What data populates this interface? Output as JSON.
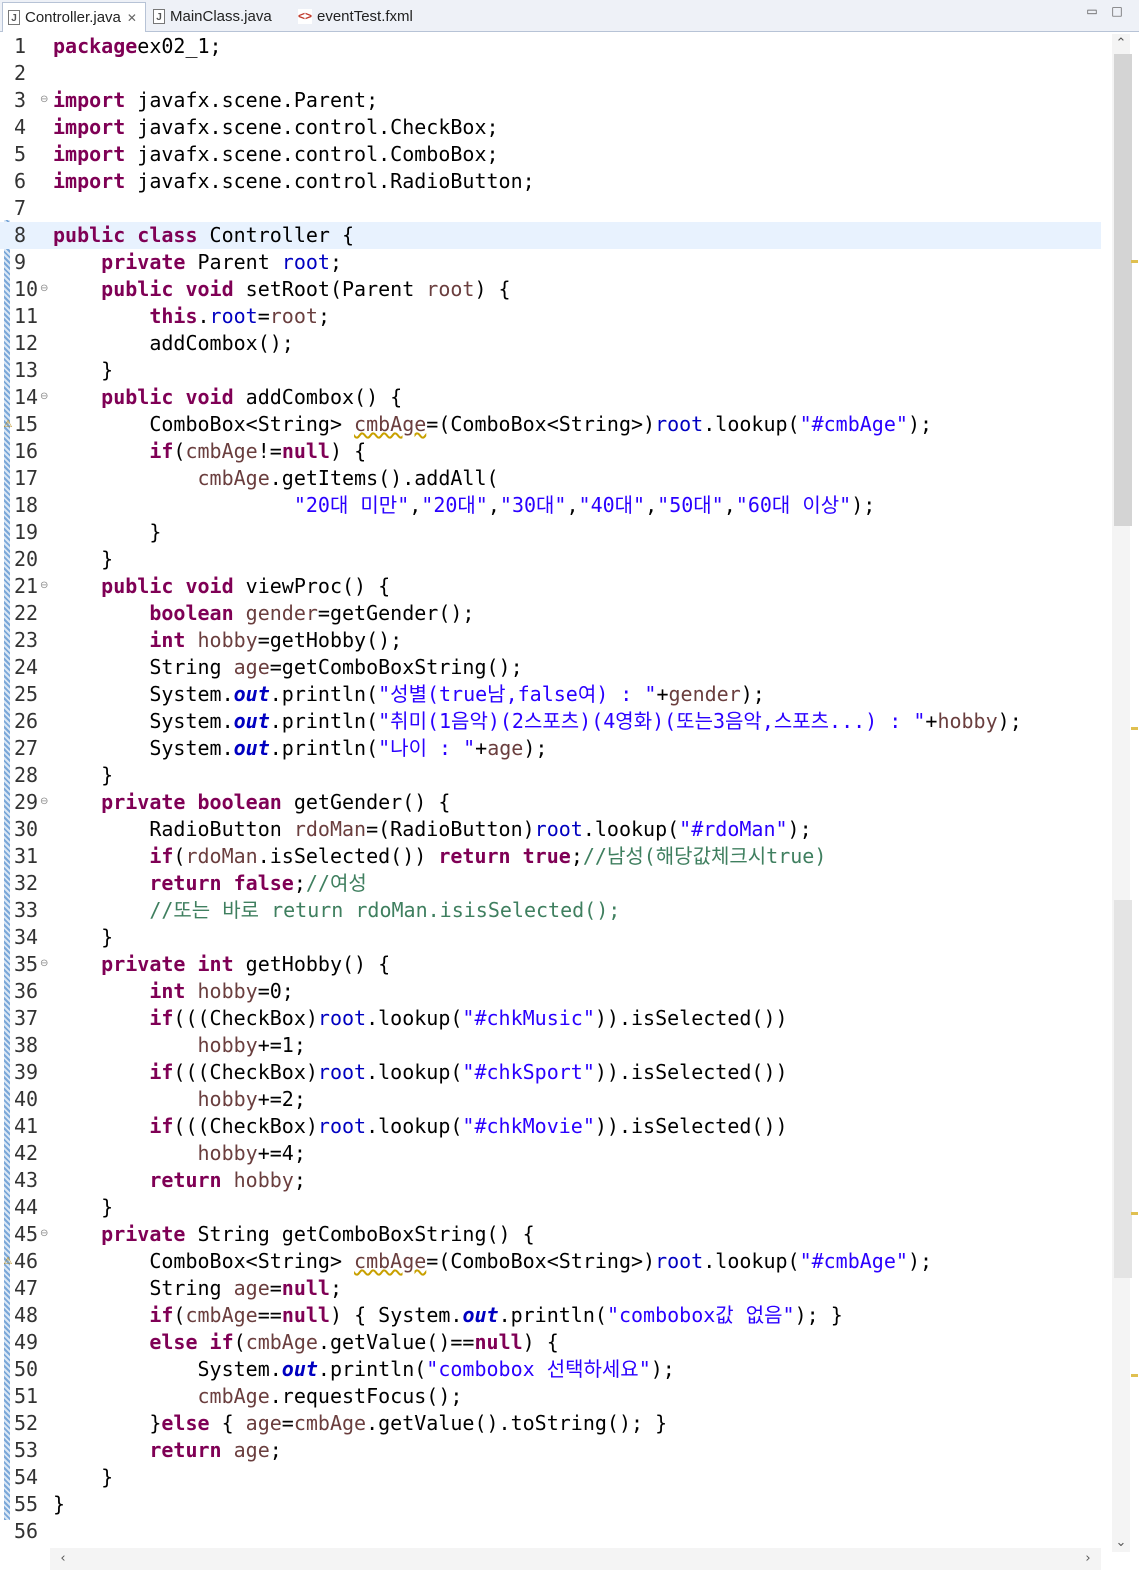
{
  "tabs": [
    {
      "label": "Controller.java",
      "icon": "java-file-icon",
      "active": true
    },
    {
      "label": "MainClass.java",
      "icon": "java-file-icon",
      "active": false
    },
    {
      "label": "eventTest.fxml",
      "icon": "fxml-file-icon",
      "active": false
    }
  ],
  "window_controls": {
    "minimize": "minimize-icon",
    "maximize": "maximize-icon"
  },
  "colors": {
    "keyword": "#7f0055",
    "field": "#0000c0",
    "string": "#2a00ff",
    "comment": "#3f7f5f",
    "local_variable": "#6a3e3e",
    "current_line": "#e8f2fe"
  },
  "current_line": 8,
  "fold_lines": [
    3,
    10,
    14,
    21,
    29,
    35,
    45
  ],
  "warning_lines": [
    15,
    46
  ],
  "lines": [
    [
      [
        "kw",
        "package"
      ],
      [
        "",
        "ex02_1;"
      ]
    ],
    [],
    [
      [
        "kw",
        "import"
      ],
      [
        "",
        " javafx.scene.Parent;"
      ]
    ],
    [
      [
        "kw",
        "import"
      ],
      [
        "",
        " javafx.scene.control.CheckBox;"
      ]
    ],
    [
      [
        "kw",
        "import"
      ],
      [
        "",
        " javafx.scene.control.ComboBox;"
      ]
    ],
    [
      [
        "kw",
        "import"
      ],
      [
        "",
        " javafx.scene.control.RadioButton;"
      ]
    ],
    [],
    [
      [
        "kw",
        "public"
      ],
      [
        "",
        " "
      ],
      [
        "kw",
        "class"
      ],
      [
        "",
        " Controller {"
      ]
    ],
    [
      [
        "",
        "    "
      ],
      [
        "kw",
        "private"
      ],
      [
        "",
        " Parent "
      ],
      [
        "fld",
        "root"
      ],
      [
        "",
        ";"
      ]
    ],
    [
      [
        "",
        "    "
      ],
      [
        "kw",
        "public"
      ],
      [
        "",
        " "
      ],
      [
        "kw",
        "void"
      ],
      [
        "",
        " setRoot(Parent "
      ],
      [
        "var",
        "root"
      ],
      [
        "",
        ") {"
      ]
    ],
    [
      [
        "",
        "        "
      ],
      [
        "kw",
        "this"
      ],
      [
        "",
        "."
      ],
      [
        "fld",
        "root"
      ],
      [
        "",
        "="
      ],
      [
        "var",
        "root"
      ],
      [
        "",
        ";"
      ]
    ],
    [
      [
        "",
        "        addCombox();"
      ]
    ],
    [
      [
        "",
        "    }"
      ]
    ],
    [
      [
        "",
        "    "
      ],
      [
        "kw",
        "public"
      ],
      [
        "",
        " "
      ],
      [
        "kw",
        "void"
      ],
      [
        "",
        " addCombox() {"
      ]
    ],
    [
      [
        "",
        "        ComboBox<String> "
      ],
      [
        "var",
        "cmbAge"
      ],
      [
        "",
        "=(ComboBox<String>)"
      ],
      [
        "fld",
        "root"
      ],
      [
        "",
        ".lookup("
      ],
      [
        "str",
        "\"#cmbAge\""
      ],
      [
        "",
        ");"
      ]
    ],
    [
      [
        "",
        "        "
      ],
      [
        "kw",
        "if"
      ],
      [
        "",
        "("
      ],
      [
        "var",
        "cmbAge"
      ],
      [
        "",
        "!="
      ],
      [
        "kw",
        "null"
      ],
      [
        "",
        ") {"
      ]
    ],
    [
      [
        "",
        "            "
      ],
      [
        "var",
        "cmbAge"
      ],
      [
        "",
        ".getItems().addAll("
      ]
    ],
    [
      [
        "",
        "                    "
      ],
      [
        "str",
        "\"20대 미만\""
      ],
      [
        "",
        ","
      ],
      [
        "str",
        "\"20대\""
      ],
      [
        "",
        ","
      ],
      [
        "str",
        "\"30대\""
      ],
      [
        "",
        ","
      ],
      [
        "str",
        "\"40대\""
      ],
      [
        "",
        ","
      ],
      [
        "str",
        "\"50대\""
      ],
      [
        "",
        ","
      ],
      [
        "str",
        "\"60대 이상\""
      ],
      [
        "",
        ");"
      ]
    ],
    [
      [
        "",
        "        }"
      ]
    ],
    [
      [
        "",
        "    }"
      ]
    ],
    [
      [
        "",
        "    "
      ],
      [
        "kw",
        "public"
      ],
      [
        "",
        " "
      ],
      [
        "kw",
        "void"
      ],
      [
        "",
        " viewProc() {"
      ]
    ],
    [
      [
        "",
        "        "
      ],
      [
        "kw",
        "boolean"
      ],
      [
        "",
        " "
      ],
      [
        "var",
        "gender"
      ],
      [
        "",
        "=getGender();"
      ]
    ],
    [
      [
        "",
        "        "
      ],
      [
        "kw",
        "int"
      ],
      [
        "",
        " "
      ],
      [
        "var",
        "hobby"
      ],
      [
        "",
        "=getHobby();"
      ]
    ],
    [
      [
        "",
        "        String "
      ],
      [
        "var",
        "age"
      ],
      [
        "",
        "=getComboBoxString();"
      ]
    ],
    [
      [
        "",
        "        System."
      ],
      [
        "sfld",
        "out"
      ],
      [
        "",
        ".println("
      ],
      [
        "str",
        "\"성별(true남,false여) : \""
      ],
      [
        "",
        "+"
      ],
      [
        "var",
        "gender"
      ],
      [
        "",
        ");"
      ]
    ],
    [
      [
        "",
        "        System."
      ],
      [
        "sfld",
        "out"
      ],
      [
        "",
        ".println("
      ],
      [
        "str",
        "\"취미(1음악)(2스포츠)(4영화)(또는3음악,스포츠...) : \""
      ],
      [
        "",
        "+"
      ],
      [
        "var",
        "hobby"
      ],
      [
        "",
        ");"
      ]
    ],
    [
      [
        "",
        "        System."
      ],
      [
        "sfld",
        "out"
      ],
      [
        "",
        ".println("
      ],
      [
        "str",
        "\"나이 : \""
      ],
      [
        "",
        "+"
      ],
      [
        "var",
        "age"
      ],
      [
        "",
        ");"
      ]
    ],
    [
      [
        "",
        "    }"
      ]
    ],
    [
      [
        "",
        "    "
      ],
      [
        "kw",
        "private"
      ],
      [
        "",
        " "
      ],
      [
        "kw",
        "boolean"
      ],
      [
        "",
        " getGender() {"
      ]
    ],
    [
      [
        "",
        "        RadioButton "
      ],
      [
        "var",
        "rdoMan"
      ],
      [
        "",
        "=(RadioButton)"
      ],
      [
        "fld",
        "root"
      ],
      [
        "",
        ".lookup("
      ],
      [
        "str",
        "\"#rdoMan\""
      ],
      [
        "",
        ");"
      ]
    ],
    [
      [
        "",
        "        "
      ],
      [
        "kw",
        "if"
      ],
      [
        "",
        "("
      ],
      [
        "var",
        "rdoMan"
      ],
      [
        "",
        ".isSelected()) "
      ],
      [
        "kw",
        "return"
      ],
      [
        "",
        " "
      ],
      [
        "kw",
        "true"
      ],
      [
        "",
        ";"
      ],
      [
        "cmt",
        "//남성(해당값체크시true)"
      ]
    ],
    [
      [
        "",
        "        "
      ],
      [
        "kw",
        "return"
      ],
      [
        "",
        " "
      ],
      [
        "kw",
        "false"
      ],
      [
        "",
        ";"
      ],
      [
        "cmt",
        "//여성"
      ]
    ],
    [
      [
        "",
        "        "
      ],
      [
        "cmt",
        "//또는 바로 return rdoMan.isisSelected();"
      ]
    ],
    [
      [
        "",
        "    }"
      ]
    ],
    [
      [
        "",
        "    "
      ],
      [
        "kw",
        "private"
      ],
      [
        "",
        " "
      ],
      [
        "kw",
        "int"
      ],
      [
        "",
        " getHobby() {"
      ]
    ],
    [
      [
        "",
        "        "
      ],
      [
        "kw",
        "int"
      ],
      [
        "",
        " "
      ],
      [
        "var",
        "hobby"
      ],
      [
        "",
        "=0;"
      ]
    ],
    [
      [
        "",
        "        "
      ],
      [
        "kw",
        "if"
      ],
      [
        "",
        "(((CheckBox)"
      ],
      [
        "fld",
        "root"
      ],
      [
        "",
        ".lookup("
      ],
      [
        "str",
        "\"#chkMusic\""
      ],
      [
        "",
        ")).isSelected())"
      ]
    ],
    [
      [
        "",
        "            "
      ],
      [
        "var",
        "hobby"
      ],
      [
        "",
        "+=1;"
      ]
    ],
    [
      [
        "",
        "        "
      ],
      [
        "kw",
        "if"
      ],
      [
        "",
        "(((CheckBox)"
      ],
      [
        "fld",
        "root"
      ],
      [
        "",
        ".lookup("
      ],
      [
        "str",
        "\"#chkSport\""
      ],
      [
        "",
        ")).isSelected())"
      ]
    ],
    [
      [
        "",
        "            "
      ],
      [
        "var",
        "hobby"
      ],
      [
        "",
        "+=2;"
      ]
    ],
    [
      [
        "",
        "        "
      ],
      [
        "kw",
        "if"
      ],
      [
        "",
        "(((CheckBox)"
      ],
      [
        "fld",
        "root"
      ],
      [
        "",
        ".lookup("
      ],
      [
        "str",
        "\"#chkMovie\""
      ],
      [
        "",
        ")).isSelected())"
      ]
    ],
    [
      [
        "",
        "            "
      ],
      [
        "var",
        "hobby"
      ],
      [
        "",
        "+=4;"
      ]
    ],
    [
      [
        "",
        "        "
      ],
      [
        "kw",
        "return"
      ],
      [
        "",
        " "
      ],
      [
        "var",
        "hobby"
      ],
      [
        "",
        ";"
      ]
    ],
    [
      [
        "",
        "    }"
      ]
    ],
    [
      [
        "",
        "    "
      ],
      [
        "kw",
        "private"
      ],
      [
        "",
        " String getComboBoxString() {"
      ]
    ],
    [
      [
        "",
        "        ComboBox<String> "
      ],
      [
        "var",
        "cmbAge"
      ],
      [
        "",
        "=(ComboBox<String>)"
      ],
      [
        "fld",
        "root"
      ],
      [
        "",
        ".lookup("
      ],
      [
        "str",
        "\"#cmbAge\""
      ],
      [
        "",
        ");"
      ]
    ],
    [
      [
        "",
        "        String "
      ],
      [
        "var",
        "age"
      ],
      [
        "",
        "="
      ],
      [
        "kw",
        "null"
      ],
      [
        "",
        ";"
      ]
    ],
    [
      [
        "",
        "        "
      ],
      [
        "kw",
        "if"
      ],
      [
        "",
        "("
      ],
      [
        "var",
        "cmbAge"
      ],
      [
        "",
        "=="
      ],
      [
        "kw",
        "null"
      ],
      [
        "",
        ") { System."
      ],
      [
        "sfld",
        "out"
      ],
      [
        "",
        ".println("
      ],
      [
        "str",
        "\"combobox값 없음\""
      ],
      [
        "",
        "); }"
      ]
    ],
    [
      [
        "",
        "        "
      ],
      [
        "kw",
        "else"
      ],
      [
        "",
        " "
      ],
      [
        "kw",
        "if"
      ],
      [
        "",
        "("
      ],
      [
        "var",
        "cmbAge"
      ],
      [
        "",
        ".getValue()=="
      ],
      [
        "kw",
        "null"
      ],
      [
        "",
        ") {"
      ]
    ],
    [
      [
        "",
        "            System."
      ],
      [
        "sfld",
        "out"
      ],
      [
        "",
        ".println("
      ],
      [
        "str",
        "\"combobox 선택하세요\""
      ],
      [
        "",
        ");"
      ]
    ],
    [
      [
        "",
        "            "
      ],
      [
        "var",
        "cmbAge"
      ],
      [
        "",
        ".requestFocus();"
      ]
    ],
    [
      [
        "",
        "        }"
      ],
      [
        "kw",
        "else"
      ],
      [
        "",
        " { "
      ],
      [
        "var",
        "age"
      ],
      [
        "",
        "="
      ],
      [
        "var",
        "cmbAge"
      ],
      [
        "",
        ".getValue().toString(); }"
      ]
    ],
    [
      [
        "",
        "        "
      ],
      [
        "kw",
        "return"
      ],
      [
        "",
        " "
      ],
      [
        "var",
        "age"
      ],
      [
        "",
        ";"
      ]
    ],
    [
      [
        "",
        "    }"
      ]
    ],
    [
      [
        "",
        "}"
      ]
    ],
    []
  ]
}
